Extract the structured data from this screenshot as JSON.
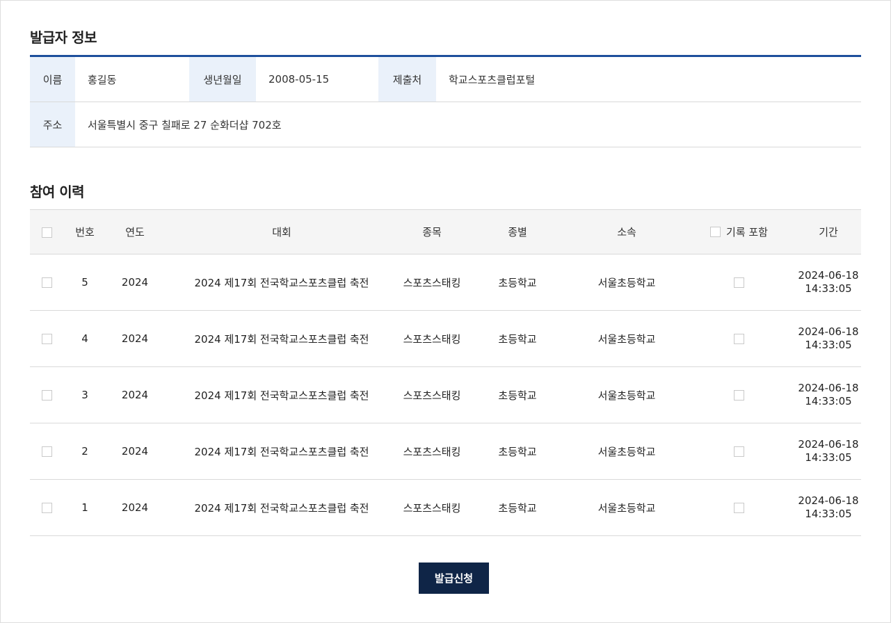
{
  "issuer": {
    "title": "발급자 정보",
    "name_label": "이름",
    "name_value": "홍길동",
    "birth_label": "생년월일",
    "birth_value": "2008-05-15",
    "submit_label": "제출처",
    "submit_value": "학교스포츠클럽포털",
    "address_label": "주소",
    "address_value": "서울특별시 중구 칠패로 27 순화더샵 702호"
  },
  "history": {
    "title": "참여 이력",
    "headers": {
      "number": "번호",
      "year": "연도",
      "contest": "대회",
      "event": "종목",
      "category": "종별",
      "affiliation": "소속",
      "include_record": "기록 포함",
      "period": "기간"
    },
    "rows": [
      {
        "number": "5",
        "year": "2024",
        "contest": "2024 제17회 전국학교스포츠클럽 축전",
        "event": "스포츠스태킹",
        "category": "초등학교",
        "affiliation": "서울초등학교",
        "date": "2024-06-18",
        "time": "14:33:05"
      },
      {
        "number": "4",
        "year": "2024",
        "contest": "2024 제17회 전국학교스포츠클럽 축전",
        "event": "스포츠스태킹",
        "category": "초등학교",
        "affiliation": "서울초등학교",
        "date": "2024-06-18",
        "time": "14:33:05"
      },
      {
        "number": "3",
        "year": "2024",
        "contest": "2024 제17회 전국학교스포츠클럽 축전",
        "event": "스포츠스태킹",
        "category": "초등학교",
        "affiliation": "서울초등학교",
        "date": "2024-06-18",
        "time": "14:33:05"
      },
      {
        "number": "2",
        "year": "2024",
        "contest": "2024 제17회 전국학교스포츠클럽 축전",
        "event": "스포츠스태킹",
        "category": "초등학교",
        "affiliation": "서울초등학교",
        "date": "2024-06-18",
        "time": "14:33:05"
      },
      {
        "number": "1",
        "year": "2024",
        "contest": "2024 제17회 전국학교스포츠클럽 축전",
        "event": "스포츠스태킹",
        "category": "초등학교",
        "affiliation": "서울초등학교",
        "date": "2024-06-18",
        "time": "14:33:05"
      }
    ]
  },
  "actions": {
    "apply_label": "발급신청"
  },
  "colors": {
    "accent_border": "#1d4f9c",
    "label_bg": "#eaf1fa",
    "button_bg": "#0f2547"
  }
}
